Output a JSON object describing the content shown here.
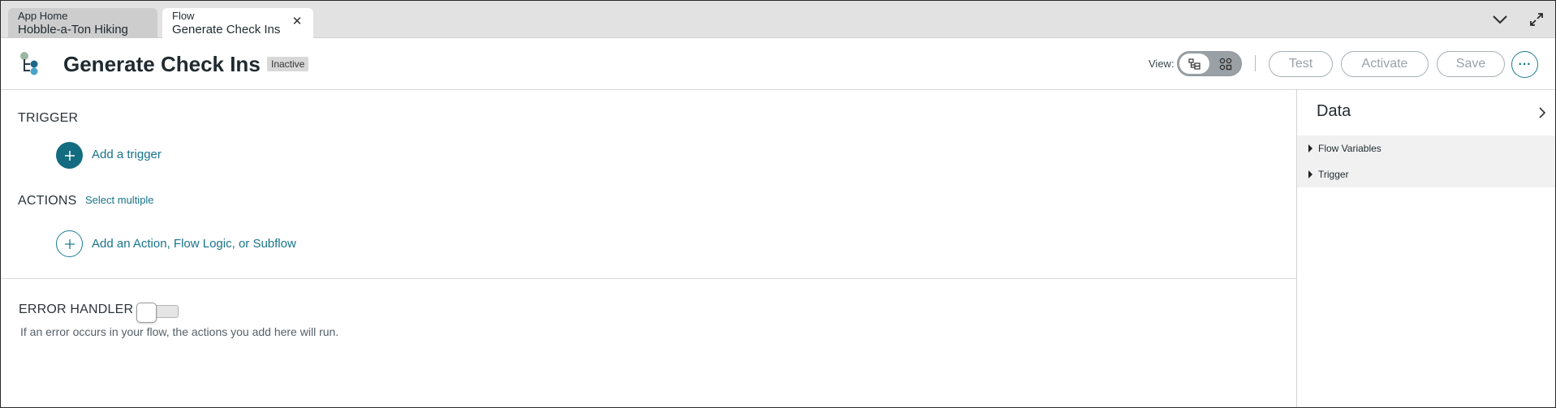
{
  "tabs": [
    {
      "type": "App Home",
      "name": "Hobble-a-Ton Hiking"
    },
    {
      "type": "Flow",
      "name": "Generate Check Ins"
    }
  ],
  "header": {
    "title": "Generate Check Ins",
    "status": "Inactive",
    "view_label": "View:",
    "buttons": {
      "test": "Test",
      "activate": "Activate",
      "save": "Save"
    }
  },
  "main": {
    "trigger_label": "TRIGGER",
    "add_trigger": "Add a trigger",
    "actions_label": "ACTIONS",
    "select_multiple": "Select multiple",
    "add_action": "Add an Action, Flow Logic, or Subflow",
    "error_handler_label": "ERROR HANDLER",
    "error_handler_enabled": false,
    "error_handler_help": "If an error occurs in your flow, the actions you add here will run."
  },
  "data_panel": {
    "title": "Data",
    "items": [
      "Flow Variables",
      "Trigger"
    ]
  },
  "colors": {
    "accent": "#136c7f",
    "link": "#17748a",
    "tab_strip": "#e2e2e2"
  }
}
